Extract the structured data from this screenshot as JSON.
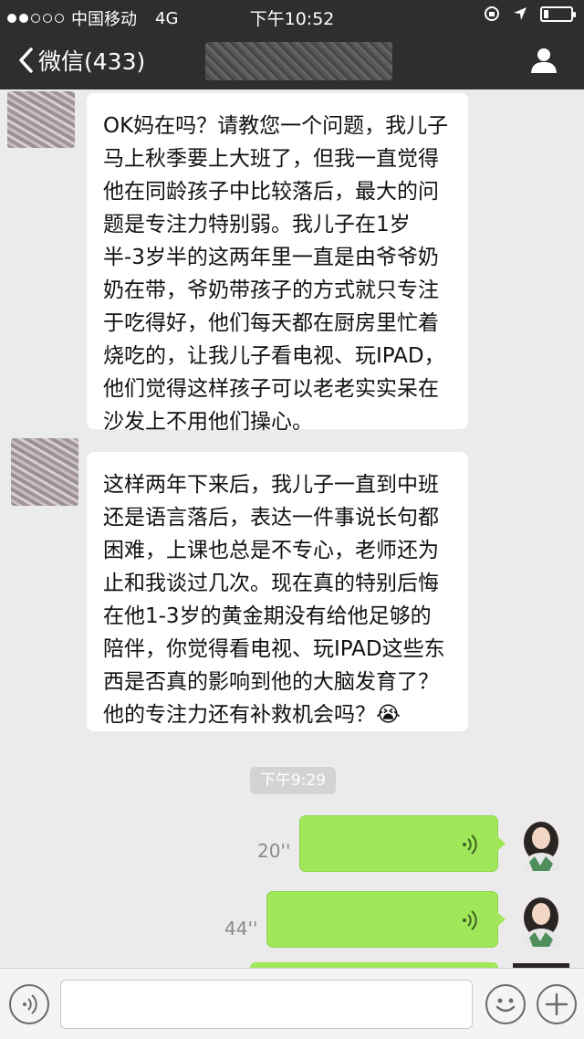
{
  "status_bar": {
    "carrier": "中国移动",
    "network": "4G",
    "time": "下午10:52"
  },
  "nav": {
    "back_label": "微信(433)"
  },
  "messages": [
    {
      "text": "OK妈在吗？请教您一个问题，我儿子马上秋季要上大班了，但我一直觉得他在同龄孩子中比较落后，最大的问题是专注力特别弱。我儿子在1岁半-3岁半的这两年里一直是由爷爷奶奶在带，爷奶带孩子的方式就只专注于吃得好，他们每天都在厨房里忙着烧吃的，让我儿子看电视、玩IPAD，他们觉得这样孩子可以老老实实呆在沙发上不用他们操心。"
    },
    {
      "text": "这样两年下来后，我儿子一直到中班还是语言落后，表达一件事说长句都困难，上课也总是不专心，老师还为止和我谈过几次。现在真的特别后悔在他1-3岁的黄金期没有给他足够的陪伴，你觉得看电视、玩IPAD这些东西是否真的影响到他的大脑发育了？他的专注力还有补救机会吗？😭"
    }
  ],
  "timestamp": "下午9:29",
  "voice_messages": [
    {
      "duration": "20''"
    },
    {
      "duration": "44''"
    }
  ],
  "input": {
    "placeholder": ""
  },
  "icons": [
    "voice-toggle-icon",
    "emoji-icon",
    "plus-icon",
    "person-icon",
    "back-chevron-icon",
    "voice-wave-icon"
  ],
  "colors": {
    "header": "#2e2e30",
    "background": "#ebebeb",
    "outgoing_bubble": "#a0e75a",
    "incoming_bubble": "#ffffff"
  }
}
